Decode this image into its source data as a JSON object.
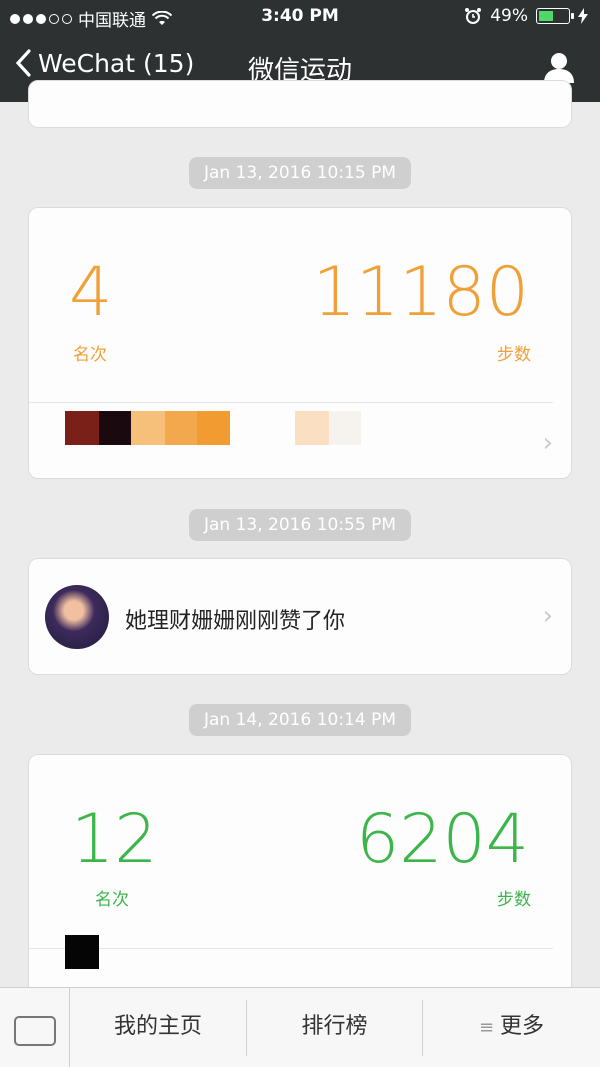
{
  "status_bar": {
    "carrier": "中国联通",
    "time": "3:40 PM",
    "battery": "49%",
    "battery_level": 0.49
  },
  "nav": {
    "back_label": "WeChat (15)",
    "title": "微信运动",
    "profile_icon": "person-icon"
  },
  "feed": [
    {
      "type": "timestamp",
      "text": "Jan 13, 2016 10:15 PM"
    },
    {
      "type": "rank_card",
      "rank": "4",
      "rank_label": "名次",
      "steps": "11180",
      "steps_label": "步数",
      "color": "#f0a037"
    },
    {
      "type": "timestamp",
      "text": "Jan 13, 2016 10:55 PM"
    },
    {
      "type": "like_card",
      "text": "她理财姗姗刚刚赞了你"
    },
    {
      "type": "timestamp",
      "text": "Jan 14, 2016 10:14 PM"
    },
    {
      "type": "rank_card",
      "rank": "12",
      "rank_label": "名次",
      "steps": "6204",
      "steps_label": "步数",
      "color": "#3cb54a"
    }
  ],
  "bottom_bar": {
    "keyboard_icon": "keyboard-icon",
    "tab_home": "我的主页",
    "tab_rank": "排行榜",
    "tab_more": "更多",
    "menu_icon": "≡"
  }
}
